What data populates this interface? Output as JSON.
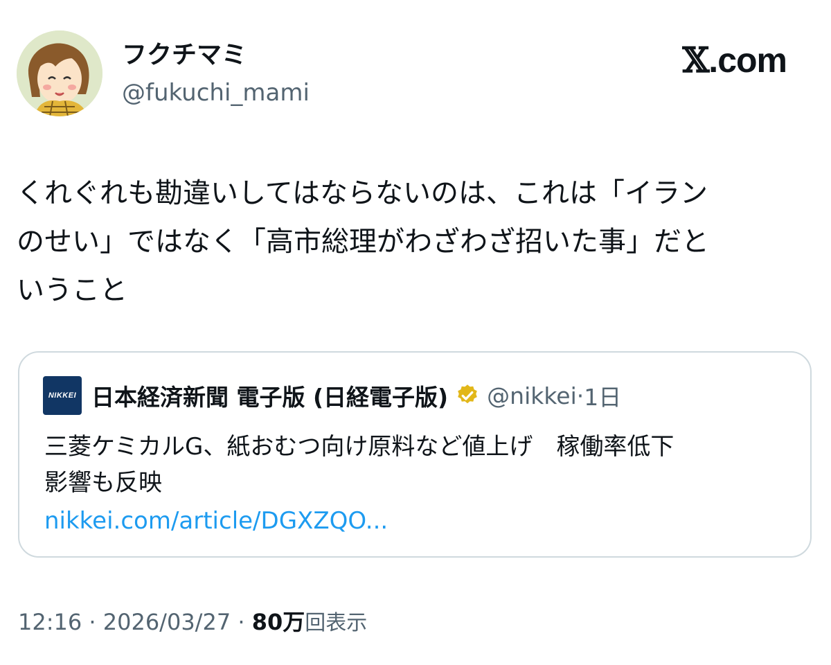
{
  "author": {
    "display_name": "フクチマミ",
    "handle": "@fukuchi_mami",
    "avatar_icon": "cartoon-avatar-icon"
  },
  "brand": {
    "x_glyph": "𝕏",
    "suffix": ".com"
  },
  "tweet": {
    "text": "くれぐれも勘違いしてはならないのは、これは「イラン\nのせい」ではなく「高市総理がわざわざ招いた事」だと\nいうこと"
  },
  "quote": {
    "logo_text": "NIKKEI",
    "name": "日本経済新聞 電子版 (日経電子版)",
    "verified_icon": "verified-badge-icon",
    "verified_color": "#e2b719",
    "handle": "@nikkei",
    "separator": "·",
    "time": "1日",
    "text": "三菱ケミカルG、紙おむつ向け原料など値上げ　稼働率低下\n影響も反映",
    "link": "nikkei.com/article/DGXZQO..."
  },
  "meta": {
    "time": "12:16",
    "sep1": " · ",
    "date": "2026/03/27",
    "sep2": " · ",
    "views_count": "80万",
    "views_label": "回表示"
  },
  "colors": {
    "text": "#0f1419",
    "secondary": "#536471",
    "link": "#1d9bf0",
    "border": "#cfd9de",
    "nikkei_logo": "#113664"
  }
}
